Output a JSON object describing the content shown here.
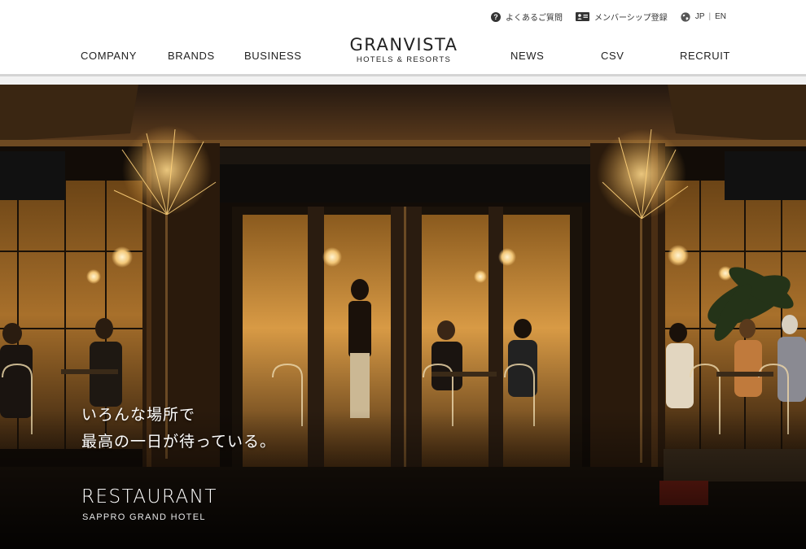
{
  "utility": {
    "faq_label": "よくあるご質問",
    "member_label": "メンバーシップ登録",
    "lang_jp": "JP",
    "lang_sep": "|",
    "lang_en": "EN"
  },
  "logo": {
    "brand": "GRANVISTA",
    "sub": "HOTELS & RESORTS"
  },
  "nav": {
    "company": "COMPANY",
    "brands": "BRANDS",
    "business": "BUSINESS",
    "news": "NEWS",
    "csv": "CSV",
    "recruit": "RECRUIT"
  },
  "hero": {
    "copy_line1": "いろんな場所で",
    "copy_line2": "最高の一日が待っている。",
    "title": "RESTAURANT",
    "subtitle": "SAPPRO GRAND HOTEL"
  },
  "colors": {
    "header_bg": "#ffffff",
    "text": "#222222",
    "rule": "#d4d4d4",
    "hero_dark": "#0d0a07",
    "warm_light": "#e7b35a"
  },
  "icons": [
    "question-circle-icon",
    "member-card-icon",
    "globe-icon"
  ]
}
